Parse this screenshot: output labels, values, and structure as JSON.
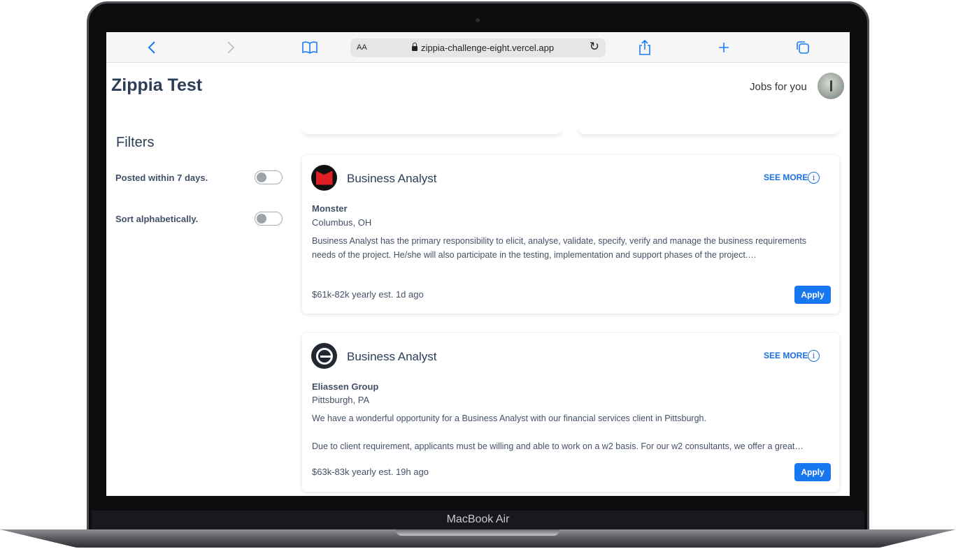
{
  "device": {
    "label": "MacBook Air"
  },
  "browser": {
    "text_size_label": "AA",
    "url": "zippia-challenge-eight.vercel.app",
    "icons": [
      "back-icon",
      "forward-icon",
      "bookmarks-icon",
      "lock-icon",
      "reload-icon",
      "share-icon",
      "new-tab-icon",
      "tabs-icon"
    ]
  },
  "header": {
    "title": "Zippia Test",
    "jobs_link": "Jobs for you"
  },
  "filters": {
    "title": "Filters",
    "items": [
      {
        "label": "Posted within 7 days.",
        "enabled": false
      },
      {
        "label": "Sort alphabetically.",
        "enabled": false
      }
    ]
  },
  "jobs": [
    {
      "title": "Business Analyst",
      "see_more": "SEE MORE",
      "company": "Monster",
      "location": "Columbus, OH",
      "description": "Business Analyst has the primary responsibility to elicit, analyse, validate, specify, verify and manage the business requirements needs of the project. He/she will also participate in the testing, implementation and support phases of the project.…",
      "description_2": "",
      "salary": "$61k-82k yearly est. 1d ago",
      "apply": "Apply",
      "logo": "monster-logo-icon"
    },
    {
      "title": "Business Analyst",
      "see_more": "SEE MORE",
      "company": "Eliassen Group",
      "location": "Pittsburgh, PA",
      "description": "We have a wonderful opportunity for a Business Analyst with our financial services client in Pittsburgh.",
      "description_2": "Due to client requirement, applicants must be willing and able to work on a w2 basis. For our w2 consultants, we offer a great…",
      "salary": "$63k-83k yearly est. 19h ago",
      "apply": "Apply",
      "logo": "eliassen-logo-icon"
    }
  ],
  "colors": {
    "accent": "#1677f0",
    "heading": "#2c3e57",
    "toolbar_icon": "#1a7cf5"
  }
}
